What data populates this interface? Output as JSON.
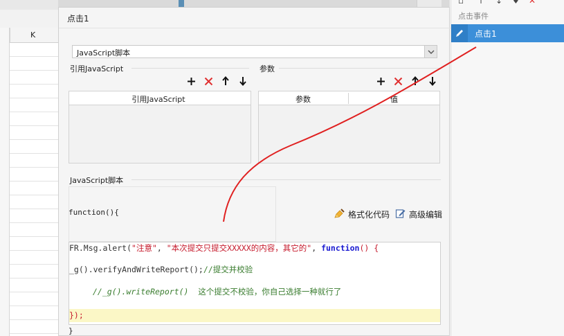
{
  "sheet": {
    "column_header": "K"
  },
  "right_panel": {
    "events_label": "点击事件",
    "event_item": "点击1"
  },
  "dialog": {
    "title": "点击1",
    "script_type": "JavaScript脚本",
    "ref_js": {
      "label": "引用JavaScript",
      "column": "引用JavaScript"
    },
    "params": {
      "label": "参数",
      "col_param": "参数",
      "col_value": "值"
    },
    "js_script": {
      "label": "JavaScript脚本",
      "fn_open": "function(){",
      "fn_close": "}",
      "format_button": "格式化代码",
      "advanced_button": "高级编辑"
    },
    "code": {
      "l1_a": "FR.Msg.alert(",
      "l1_s1": "\"注意\"",
      "l1_c": ", ",
      "l1_s2": "\"本次提交只提交XXXXX的内容，其它的\"",
      "l1_d": ", ",
      "l1_kw": "function",
      "l1_e": "() {",
      "l2_a": "_g().verifyAndWriteReport();",
      "l2_cm": "//提交并校验",
      "l3_cm": "//_g().writeReport()",
      "l3_b": "  这个提交不校验，你自己选择一种就行了",
      "l4": "});"
    }
  },
  "colors": {
    "accent": "#3c8fd9",
    "delete_red": "#e03030",
    "annotation_red": "#e02020",
    "highlight": "#fbf7c6"
  }
}
